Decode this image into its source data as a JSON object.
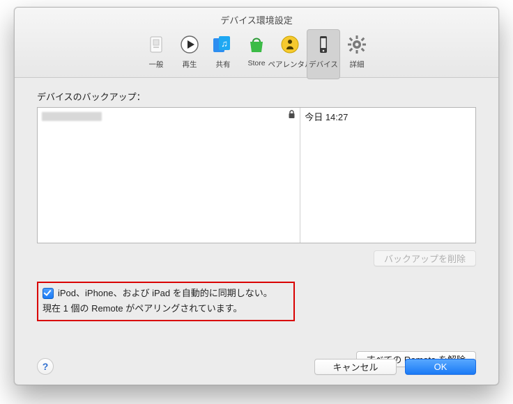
{
  "window": {
    "title": "デバイス環境設定"
  },
  "toolbar": {
    "items": [
      {
        "id": "general",
        "label": "一般"
      },
      {
        "id": "playback",
        "label": "再生"
      },
      {
        "id": "sharing",
        "label": "共有"
      },
      {
        "id": "store",
        "label": "Store"
      },
      {
        "id": "parental",
        "label": "ペアレンタル"
      },
      {
        "id": "devices",
        "label": "デバイス",
        "selected": true
      },
      {
        "id": "advanced",
        "label": "詳細"
      }
    ]
  },
  "section": {
    "backups_label": "デバイスのバックアップ：",
    "rows": [
      {
        "device": "",
        "time": "今日 14:27",
        "locked": true
      }
    ],
    "delete_backup": "バックアップを削除"
  },
  "options": {
    "no_auto_sync": "iPod、iPhone、および iPad を自動的に同期しない。",
    "no_auto_sync_checked": true,
    "pairing_status": "現在 1 個の Remote がペアリングされています。",
    "forget_all_remotes": "すべての Remote を解除"
  },
  "footer": {
    "help": "?",
    "cancel": "キャンセル",
    "ok": "OK"
  }
}
